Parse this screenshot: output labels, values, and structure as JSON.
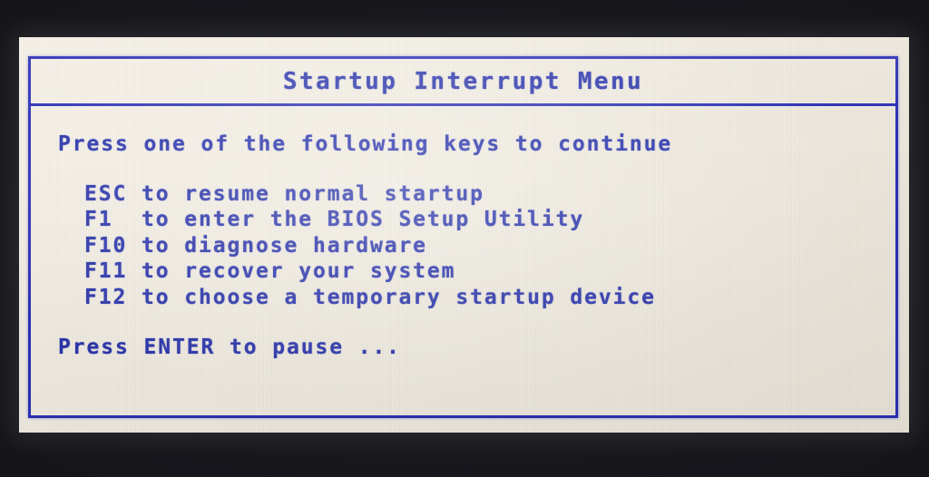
{
  "screen": {
    "title": "Startup Interrupt Menu",
    "intro": "Press one of the following keys to continue",
    "footer": "Press ENTER to pause ...",
    "keys": [
      {
        "key": "ESC",
        "key_padded": "ESC ",
        "description": "to resume normal startup",
        "full": "ESC to resume normal startup"
      },
      {
        "key": "F1",
        "key_padded": "F1  ",
        "description": "to enter the BIOS Setup Utility",
        "full": "F1  to enter the BIOS Setup Utility"
      },
      {
        "key": "F10",
        "key_padded": "F10 ",
        "description": "to diagnose hardware",
        "full": "F10 to diagnose hardware"
      },
      {
        "key": "F11",
        "key_padded": "F11 ",
        "description": "to recover your system",
        "full": "F11 to recover your system"
      },
      {
        "key": "F12",
        "key_padded": "F12 ",
        "description": "to choose a temporary startup device",
        "full": "F12 to choose a temporary startup device"
      }
    ],
    "colors": {
      "text_blue": "#2b35ab",
      "border_blue": "#2b2fb4",
      "panel_cream": "#efeadf",
      "bezel_black": "#17171d"
    }
  }
}
